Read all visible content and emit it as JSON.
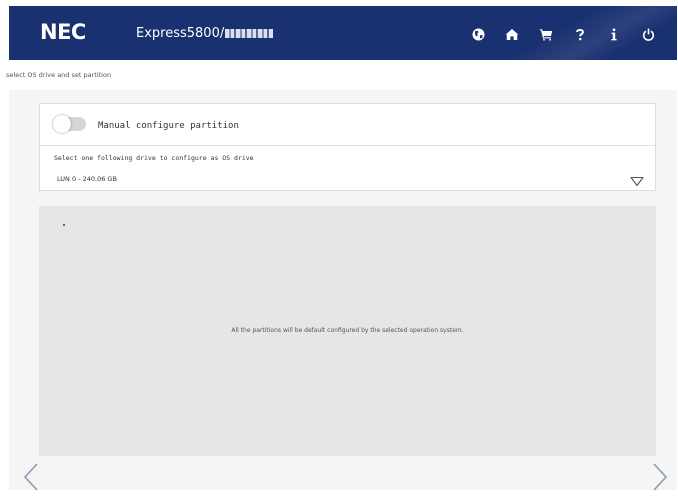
{
  "header": {
    "logo": "NEC",
    "product_title": "Express5800/",
    "background_color": "#1a3171",
    "toolbar": [
      {
        "name": "globe-icon",
        "label": "language"
      },
      {
        "name": "home-icon",
        "label": "home"
      },
      {
        "name": "cart-icon",
        "label": "cart"
      },
      {
        "name": "help-icon",
        "label": "help"
      },
      {
        "name": "info-icon",
        "label": "info"
      },
      {
        "name": "power-icon",
        "label": "power"
      }
    ]
  },
  "breadcrumb": "select OS drive and set partition",
  "config": {
    "toggle_label": "Manual configure partition",
    "toggle_on": false,
    "select_label": "Select one following drive to configure as OS drive",
    "selected_drive": "LUN 0 - 240.06 GB"
  },
  "partition_area": {
    "message": "All the partitions will be default configured by the selected operation system."
  },
  "navigation": {
    "prev_icon": "chevron-left-icon",
    "next_icon": "chevron-right-icon",
    "arrow_color": "#8a9ab6"
  }
}
